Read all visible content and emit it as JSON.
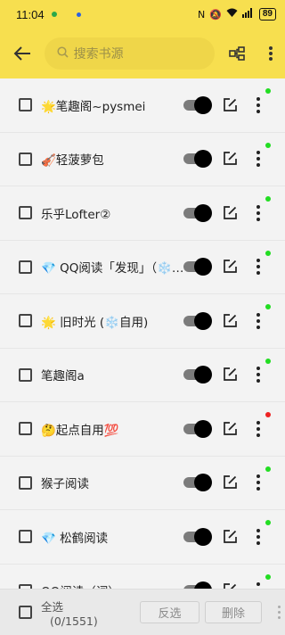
{
  "status_bar": {
    "time": "11:04",
    "icons": [
      "nfc-icon",
      "mute-icon",
      "wifi-icon",
      "signal-icon"
    ],
    "battery": "89"
  },
  "toolbar": {
    "back_icon": "arrow-left-icon",
    "search_placeholder": "搜索书源",
    "group_icon": "group-icon",
    "more_icon": "more-vert-icon"
  },
  "sources": [
    {
      "name": "🌟笔趣阁~pysmei",
      "enabled": true,
      "status_color": "#22dd22"
    },
    {
      "name": "🎻轻菠萝包",
      "enabled": true,
      "status_color": "#22dd22"
    },
    {
      "name": "乐乎Lofter②",
      "enabled": true,
      "status_color": "#22dd22"
    },
    {
      "name": "💎 QQ阅读「发现」（❄️自用）",
      "enabled": true,
      "status_color": "#22dd22"
    },
    {
      "name": "🌟 旧时光 (❄️自用)",
      "enabled": true,
      "status_color": "#22dd22"
    },
    {
      "name": "笔趣阁a",
      "enabled": true,
      "status_color": "#22dd22"
    },
    {
      "name": "🤔起点自用💯",
      "enabled": true,
      "status_color": "#ee2222"
    },
    {
      "name": "猴子阅读",
      "enabled": true,
      "status_color": "#22dd22"
    },
    {
      "name": "💎 松鹤阅读",
      "enabled": true,
      "status_color": "#22dd22"
    },
    {
      "name": "QQ阅读（词）",
      "enabled": true,
      "status_color": "#22dd22"
    }
  ],
  "bottom_bar": {
    "select_all_label": "全选",
    "selected_count": "(0/1551)",
    "invert_label": "反选",
    "delete_label": "删除"
  }
}
